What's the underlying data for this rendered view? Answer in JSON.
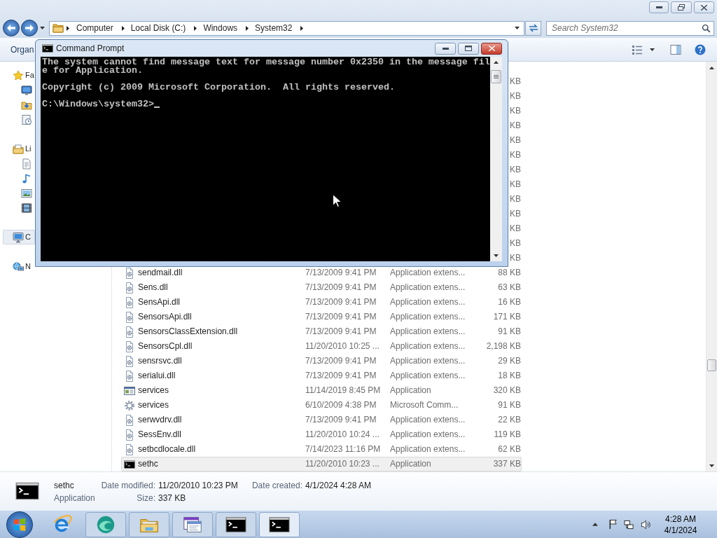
{
  "address_bar": {
    "breadcrumbs": [
      "Computer",
      "Local Disk (C:)",
      "Windows",
      "System32"
    ]
  },
  "search": {
    "placeholder": "Search System32"
  },
  "toolbar": {
    "organize": "Organ"
  },
  "navigation": [
    {
      "kind": "favorites",
      "label": "Fa",
      "selected": false,
      "children": [
        {
          "kind": "desktop",
          "selected": false
        },
        {
          "kind": "downloads",
          "selected": false
        },
        {
          "kind": "recent",
          "selected": false
        }
      ]
    },
    {
      "kind": "libraries",
      "label": "Li",
      "selected": false,
      "children": [
        {
          "kind": "documents",
          "selected": false
        },
        {
          "kind": "music",
          "selected": false
        },
        {
          "kind": "pictures",
          "selected": false
        },
        {
          "kind": "videos",
          "selected": false
        }
      ]
    },
    {
      "kind": "computer",
      "label": "C",
      "selected": true
    },
    {
      "kind": "network",
      "label": "N",
      "selected": false
    }
  ],
  "files": [
    {
      "size": "KB",
      "selected": false
    },
    {
      "size": "KB",
      "selected": false
    },
    {
      "size": "KB",
      "selected": false
    },
    {
      "size": "KB",
      "selected": false
    },
    {
      "size": "KB",
      "selected": false
    },
    {
      "size": "KB",
      "selected": false
    },
    {
      "size": "KB",
      "selected": false
    },
    {
      "size": "KB",
      "selected": false
    },
    {
      "size": "KB",
      "selected": false
    },
    {
      "size": "KB",
      "selected": false
    },
    {
      "size": "KB",
      "selected": false
    },
    {
      "size": "KB",
      "selected": false
    },
    {
      "size": "KB",
      "selected": false
    },
    {
      "kind": "dll",
      "name": "sendmail.dll",
      "date": "7/13/2009 9:41 PM",
      "type": "Application extens...",
      "size": "88 KB",
      "selected": false
    },
    {
      "kind": "dll",
      "name": "Sens.dll",
      "date": "7/13/2009 9:41 PM",
      "type": "Application extens...",
      "size": "63 KB",
      "selected": false
    },
    {
      "kind": "dll",
      "name": "SensApi.dll",
      "date": "7/13/2009 9:41 PM",
      "type": "Application extens...",
      "size": "16 KB",
      "selected": false
    },
    {
      "kind": "dll",
      "name": "SensorsApi.dll",
      "date": "7/13/2009 9:41 PM",
      "type": "Application extens...",
      "size": "171 KB",
      "selected": false
    },
    {
      "kind": "dll",
      "name": "SensorsClassExtension.dll",
      "date": "7/13/2009 9:41 PM",
      "type": "Application extens...",
      "size": "91 KB",
      "selected": false
    },
    {
      "kind": "dll",
      "name": "SensorsCpl.dll",
      "date": "11/20/2010 10:25 ...",
      "type": "Application extens...",
      "size": "2,198 KB",
      "selected": false
    },
    {
      "kind": "dll",
      "name": "sensrsvc.dll",
      "date": "7/13/2009 9:41 PM",
      "type": "Application extens...",
      "size": "29 KB",
      "selected": false
    },
    {
      "kind": "dll",
      "name": "serialui.dll",
      "date": "7/13/2009 9:41 PM",
      "type": "Application extens...",
      "size": "18 KB",
      "selected": false
    },
    {
      "kind": "app",
      "name": "services",
      "date": "11/14/2019 8:45 PM",
      "type": "Application",
      "size": "320 KB",
      "selected": false
    },
    {
      "kind": "snapin",
      "name": "services",
      "date": "6/10/2009 4:38 PM",
      "type": "Microsoft Comm...",
      "size": "91 KB",
      "selected": false
    },
    {
      "kind": "dll",
      "name": "serwvdrv.dll",
      "date": "7/13/2009 9:41 PM",
      "type": "Application extens...",
      "size": "22 KB",
      "selected": false
    },
    {
      "kind": "dll",
      "name": "SessEnv.dll",
      "date": "11/20/2010 10:24 ...",
      "type": "Application extens...",
      "size": "119 KB",
      "selected": false
    },
    {
      "kind": "dll",
      "name": "setbcdlocale.dll",
      "date": "7/14/2023 11:16 PM",
      "type": "Application extens...",
      "size": "62 KB",
      "selected": false
    },
    {
      "kind": "console",
      "name": "sethc",
      "date": "11/20/2010 10:23 ...",
      "type": "Application",
      "size": "337 KB",
      "selected": true
    }
  ],
  "details": {
    "kind": "console",
    "name": "sethc",
    "type": "Application",
    "columns": [
      [
        {
          "label": "Date modified:",
          "value": "11/20/2010 10:23 PM"
        },
        {
          "label": "Size:",
          "value": "337 KB"
        }
      ],
      [
        {
          "label": "Date created:",
          "value": "4/1/2024 4:28 AM"
        }
      ]
    ]
  },
  "console_window": {
    "title": "Command Prompt",
    "output": [
      "The system cannot find message text for message number 0x2350 in the message file for Application.",
      "Copyright (c) 2009 Microsoft Corporation.  All rights reserved."
    ],
    "prompt": "C:\\Windows\\system32>"
  },
  "taskbar": {
    "items": [
      {
        "kind": "browser",
        "running": false,
        "active": false
      },
      {
        "kind": "wave",
        "running": true,
        "active": false
      },
      {
        "kind": "folder",
        "running": true,
        "active": false
      },
      {
        "kind": "windows",
        "running": true,
        "active": false
      },
      {
        "kind": "console",
        "running": true,
        "active": false
      },
      {
        "kind": "console",
        "running": true,
        "active": true
      }
    ],
    "clock": {
      "time": "4:28 AM",
      "date": "4/1/2024"
    }
  }
}
